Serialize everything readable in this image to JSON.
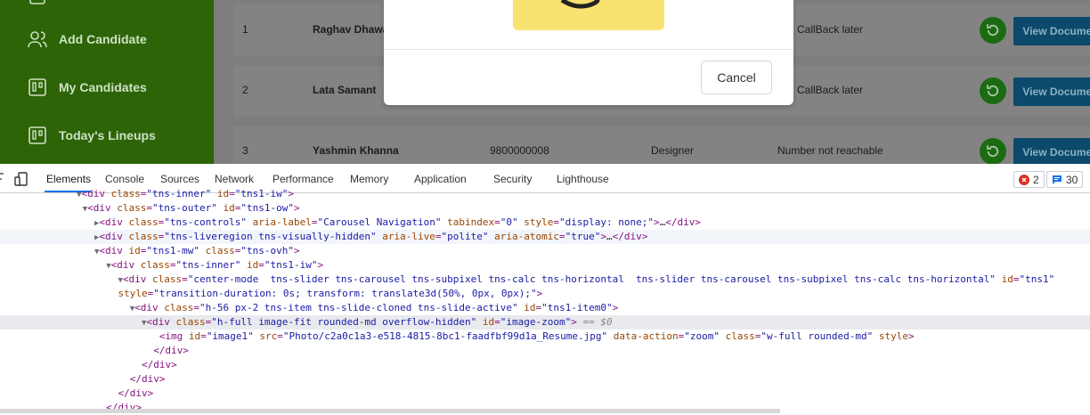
{
  "sidebar": {
    "items": [
      {
        "label": "Add Candidate",
        "icon": "users-icon"
      },
      {
        "label": "My Candidates",
        "icon": "board-icon"
      },
      {
        "label": "Today's Lineups",
        "icon": "board-icon"
      }
    ]
  },
  "rows": [
    {
      "index": "1",
      "name": "Raghav Dhawa",
      "phone": "",
      "role": "",
      "status": "CallBack later",
      "button": "View Document"
    },
    {
      "index": "2",
      "name": "Lata Samant",
      "phone": "",
      "role": "",
      "status": "CallBack later",
      "button": "View Document"
    },
    {
      "index": "3",
      "name": "Yashmin Khanna",
      "phone": "9800000008",
      "role": "Designer",
      "status": "Number not reachable",
      "button": "View Document"
    }
  ],
  "modal": {
    "cancel_label": "Cancel"
  },
  "devtools": {
    "tabs": [
      "Elements",
      "Console",
      "Sources",
      "Network",
      "Performance",
      "Memory",
      "Application",
      "Security",
      "Lighthouse"
    ],
    "active_tab": "Elements",
    "errors": "2",
    "messages": "30",
    "dom_eq": "== $0"
  },
  "colors": {
    "sidebar": "#2c6407",
    "button": "#0b4a6b",
    "reload": "#1c6b12",
    "accent": "#1a73e8"
  }
}
